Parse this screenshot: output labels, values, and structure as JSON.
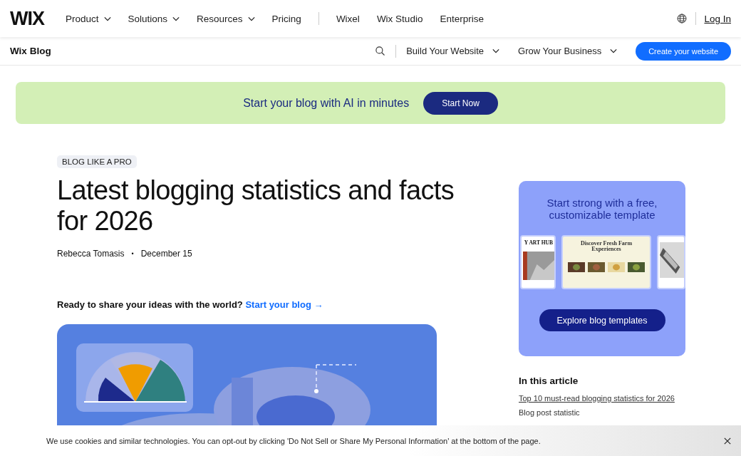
{
  "top_nav": {
    "logo": "WIX",
    "primary_items": [
      {
        "label": "Product",
        "kind": "dropdown"
      },
      {
        "label": "Solutions",
        "kind": "dropdown"
      },
      {
        "label": "Resources",
        "kind": "dropdown"
      },
      {
        "label": "Pricing",
        "kind": "link"
      }
    ],
    "secondary_items": [
      {
        "label": "Wixel"
      },
      {
        "label": "Wix Studio"
      },
      {
        "label": "Enterprise"
      }
    ],
    "login": "Log In"
  },
  "sub_nav": {
    "title": "Wix Blog",
    "menus": [
      {
        "label": "Build Your Website",
        "kind": "dropdown"
      },
      {
        "label": "Grow Your Business",
        "kind": "dropdown"
      }
    ],
    "button": "Create your website"
  },
  "banner": {
    "text": "Start your blog with AI in minutes",
    "button": "Start Now"
  },
  "article": {
    "tag": "BLOG LIKE A PRO",
    "title": "Latest blogging statistics and facts for 2026",
    "author": "Rebecca Tomasis",
    "separator": "•",
    "date": "December 15",
    "cta": {
      "text": "Ready to share your ideas with the world?",
      "link": "Start your blog →"
    }
  },
  "template_card": {
    "heading": "Start strong with a free, customizable template",
    "templates": [
      {
        "title": "Y ART HUB"
      },
      {
        "title": "Discover Fresh Farm Experiences"
      }
    ],
    "button": "Explore blog templates"
  },
  "toc": {
    "heading": "In this article",
    "items": [
      {
        "label": "Top 10 must-read blogging statistics for 2026",
        "selected": true
      },
      {
        "label": "Blog post statistic",
        "selected": false
      }
    ]
  },
  "cookie_bar": {
    "text": "We use cookies and similar technologies. You can opt-out by clicking 'Do Not Sell or Share My Personal Information' at the bottom of the page."
  }
}
